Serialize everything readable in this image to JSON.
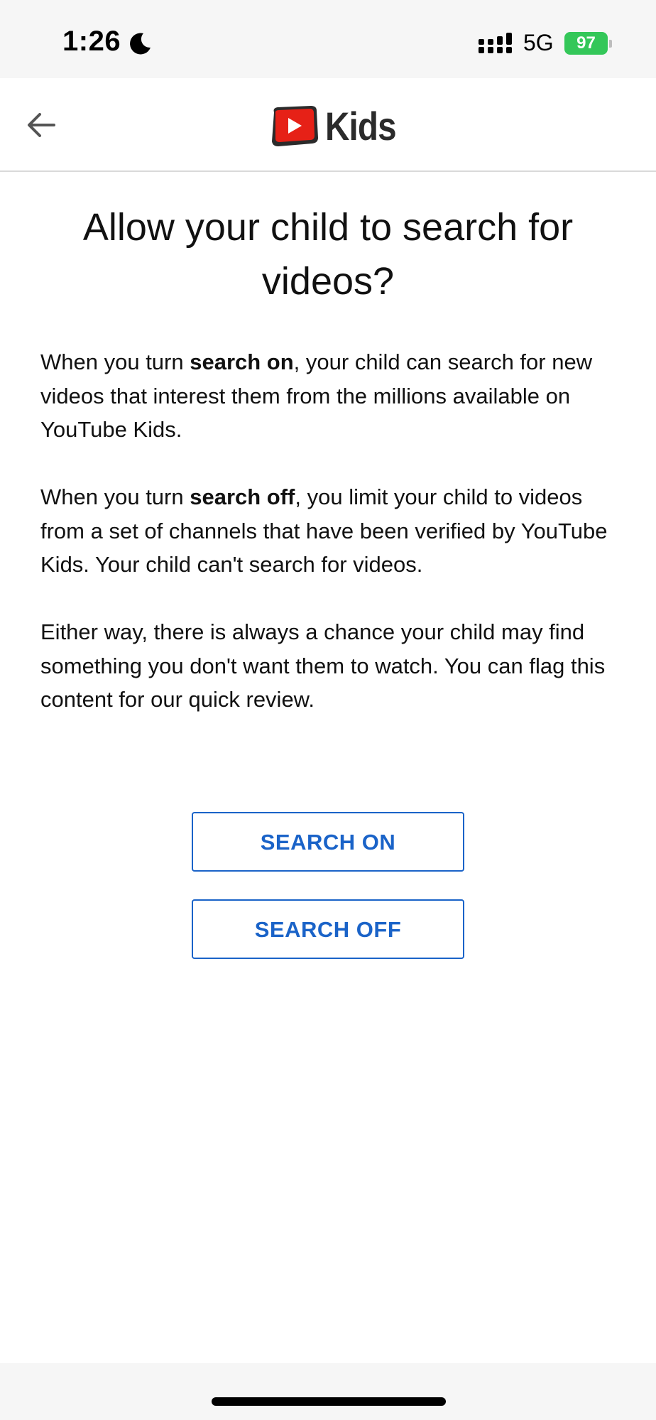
{
  "status_bar": {
    "time": "1:26",
    "network": "5G",
    "battery": "97",
    "icons": [
      "moon-icon",
      "signal-icon",
      "battery-icon"
    ]
  },
  "header": {
    "logo_text": "Kids",
    "icons": [
      "back-arrow-icon",
      "youtube-play-logo-icon"
    ]
  },
  "main": {
    "title": "Allow your child to search for videos?",
    "paragraphs": [
      {
        "pre": "When you turn ",
        "bold": "search on",
        "post": ", your child can search for new videos that interest them from the millions available on YouTube Kids."
      },
      {
        "pre": "When you turn ",
        "bold": "search off",
        "post": ", you limit your child to videos from a set of channels that have been verified by YouTube Kids. Your child can't search for videos."
      },
      {
        "text": "Either way, there is always a chance your child may find something you don't want them to watch. You can flag this content for our quick review."
      }
    ],
    "buttons": {
      "search_on": "SEARCH ON",
      "search_off": "SEARCH OFF"
    }
  },
  "colors": {
    "accent": "#1a63c8",
    "youtube_red": "#e62117",
    "battery_green": "#34c759"
  }
}
